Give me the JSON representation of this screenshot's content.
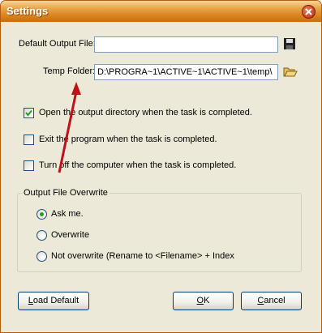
{
  "window": {
    "title": "Settings"
  },
  "fields": {
    "default_output_label": "Default Output File:",
    "default_output_value": "",
    "temp_folder_label": "Temp Folder:",
    "temp_folder_value": "D:\\PROGRA~1\\ACTIVE~1\\ACTIVE~1\\temp\\"
  },
  "options": [
    {
      "label": "Open the output directory when the task is completed.",
      "checked": true
    },
    {
      "label": "Exit the program when the task is completed.",
      "checked": false
    },
    {
      "label": "Turn off the computer when the task is completed.",
      "checked": false
    }
  ],
  "overwrite": {
    "title": "Output File Overwrite",
    "choices": [
      {
        "label": "Ask me.",
        "selected": true
      },
      {
        "label": "Overwrite",
        "selected": false
      },
      {
        "label": "Not overwrite (Rename to <Filename> + Index",
        "selected": false
      }
    ]
  },
  "buttons": {
    "load_default": {
      "mnemonic": "L",
      "rest": "oad Default"
    },
    "ok": {
      "mnemonic": "O",
      "rest": "K"
    },
    "cancel": {
      "mnemonic": "C",
      "rest": "ancel"
    }
  },
  "colors": {
    "title_bar": "#d98320",
    "dialog_bg": "#ece9d8",
    "accent_arrow": "#c0101a",
    "check_green": "#21a121"
  },
  "icons": {
    "save": "floppy-disk-icon",
    "folder": "open-folder-icon",
    "close": "close-icon"
  }
}
